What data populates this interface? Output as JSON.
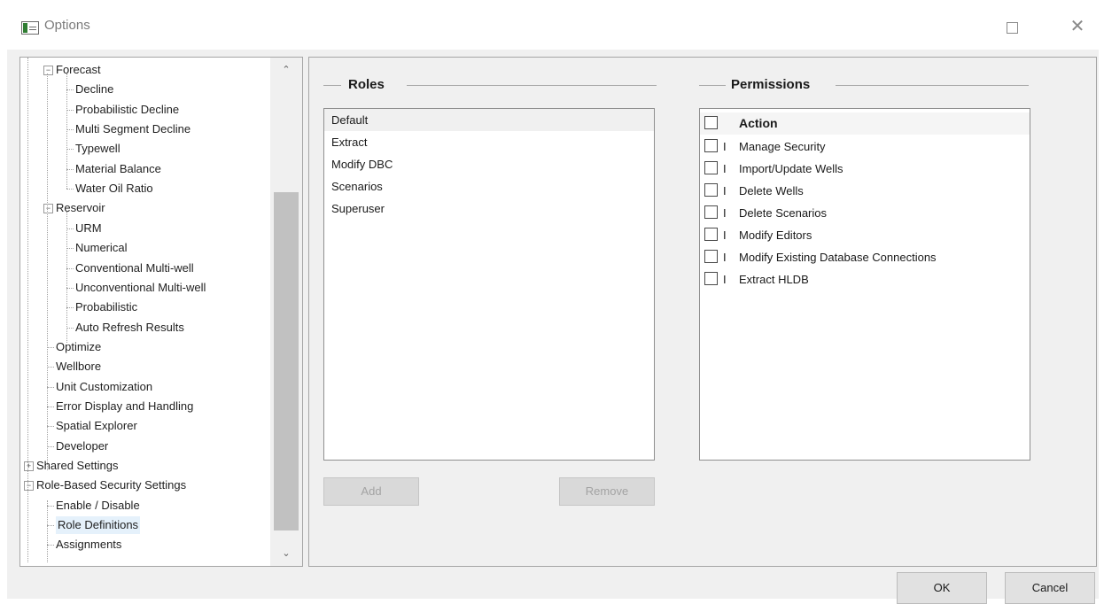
{
  "window": {
    "title": "Options",
    "maximize_glyph": "",
    "close_glyph": "✕"
  },
  "tree": {
    "items": [
      {
        "label": "Forecast",
        "level": 1,
        "expander": "−"
      },
      {
        "label": "Decline",
        "level": 2
      },
      {
        "label": "Probabilistic Decline",
        "level": 2
      },
      {
        "label": "Multi Segment Decline",
        "level": 2
      },
      {
        "label": "Typewell",
        "level": 2
      },
      {
        "label": "Material Balance",
        "level": 2
      },
      {
        "label": "Water Oil Ratio",
        "level": 2
      },
      {
        "label": "Reservoir",
        "level": 1,
        "expander": "−"
      },
      {
        "label": "URM",
        "level": 2
      },
      {
        "label": "Numerical",
        "level": 2
      },
      {
        "label": "Conventional Multi-well",
        "level": 2
      },
      {
        "label": "Unconventional Multi-well",
        "level": 2
      },
      {
        "label": "Probabilistic",
        "level": 2
      },
      {
        "label": "Auto Refresh Results",
        "level": 2
      },
      {
        "label": "Optimize",
        "level": 1
      },
      {
        "label": "Wellbore",
        "level": 1
      },
      {
        "label": "Unit Customization",
        "level": 1
      },
      {
        "label": "Error Display and Handling",
        "level": 1
      },
      {
        "label": "Spatial Explorer",
        "level": 1
      },
      {
        "label": "Developer",
        "level": 1
      },
      {
        "label": "Shared Settings",
        "level": 0,
        "expander": "+"
      },
      {
        "label": "Role-Based Security Settings",
        "level": 0,
        "expander": "−"
      },
      {
        "label": "Enable / Disable",
        "level": 1
      },
      {
        "label": "Role Definitions",
        "level": 1,
        "selected": true
      },
      {
        "label": "Assignments",
        "level": 1
      }
    ],
    "scroll_up": "⌃",
    "scroll_down": "⌄"
  },
  "roles": {
    "title": "Roles",
    "items": [
      "Default",
      "Extract",
      "Modify DBC",
      "Scenarios",
      "Superuser"
    ],
    "selected_index": 0,
    "add_label": "Add",
    "remove_label": "Remove"
  },
  "permissions": {
    "title": "Permissions",
    "header": "Action",
    "items": [
      {
        "code": "I",
        "label": "Manage Security"
      },
      {
        "code": "I",
        "label": "Import/Update Wells"
      },
      {
        "code": "I",
        "label": "Delete Wells"
      },
      {
        "code": "I",
        "label": "Delete Scenarios"
      },
      {
        "code": "I",
        "label": "Modify Editors"
      },
      {
        "code": "I",
        "label": "Modify Existing Database Connections"
      },
      {
        "code": "I",
        "label": "Extract HLDB"
      }
    ]
  },
  "dialog": {
    "ok_label": "OK",
    "cancel_label": "Cancel"
  }
}
